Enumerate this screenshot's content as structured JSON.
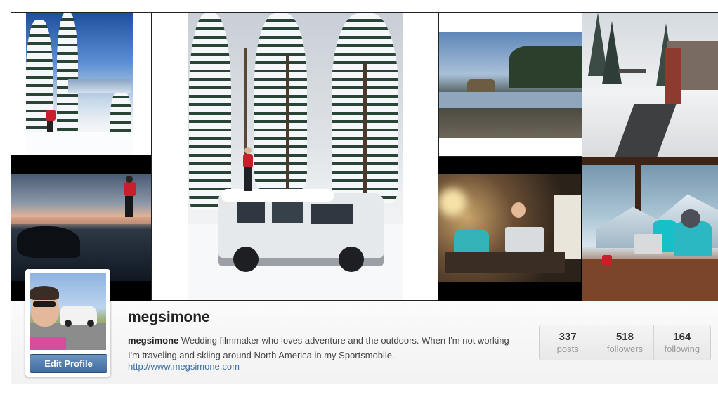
{
  "profile": {
    "username": "megsimone",
    "bio_name": "megsimone",
    "bio_text": " Wedding filmmaker who loves adventure and the outdoors. When I'm not working I'm traveling and skiing around North America in my Sportsmobile.",
    "website": "http://www.megsimone.com",
    "edit_button": "Edit Profile"
  },
  "stats": [
    {
      "number": "337",
      "label": "posts"
    },
    {
      "number": "518",
      "label": "followers"
    },
    {
      "number": "164",
      "label": "following"
    }
  ],
  "photos": [
    {
      "subject": "skier on snowy mountain"
    },
    {
      "subject": "snow-covered van in forest"
    },
    {
      "subject": "coastal rocks and tide pools"
    },
    {
      "subject": "ski lodge in snowfall"
    },
    {
      "subject": "person on beach at sunset"
    },
    {
      "subject": "woman in van with laptop"
    },
    {
      "subject": "person at window with mountain view"
    }
  ],
  "colors": {
    "accent_blue": "#3b6fa0",
    "button_blue": "#4f7db0",
    "jacket_red": "#c8202a"
  }
}
